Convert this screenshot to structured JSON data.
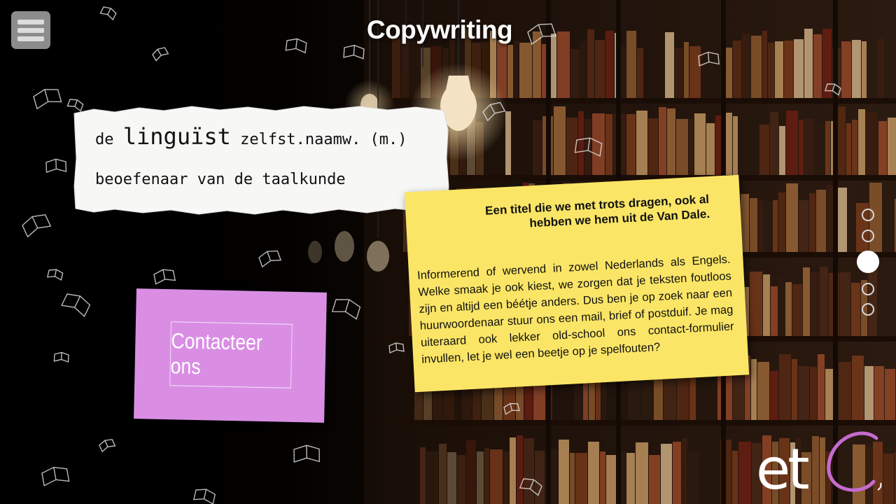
{
  "page": {
    "title": "Copywriting"
  },
  "menu": {
    "icon": "hamburger-menu-icon"
  },
  "definition": {
    "article": "de",
    "word": "linguïst",
    "grammar": "zelfst.naamw. (m.)",
    "meaning": "beoefenaar van de taalkunde"
  },
  "contact": {
    "label": "Contacteer ons",
    "color": "#d98ee4"
  },
  "note": {
    "heading": "Een titel die we met trots dragen, ook al hebben we hem uit de Van Dale.",
    "body": "Informerend of wervend in zowel Nederlands als Engels. Welke smaak je ook kiest, we zorgen dat je teksten foutloos zijn en altijd een béétje anders. Dus ben je op zoek naar een huurwoordenaar stuur ons een mail, brief of postduif. Je mag uiteraard ook lekker old-school ons contact-formulier invullen, let je wel een beetje op je spelfouten?",
    "color": "#fbe566"
  },
  "pagination": {
    "total": 5,
    "active_index": 2
  },
  "logo": {
    "text": "etc",
    "accent": "#c56bd0"
  },
  "colors": {
    "background": "#000000",
    "lamp": "#f3d9a8"
  }
}
